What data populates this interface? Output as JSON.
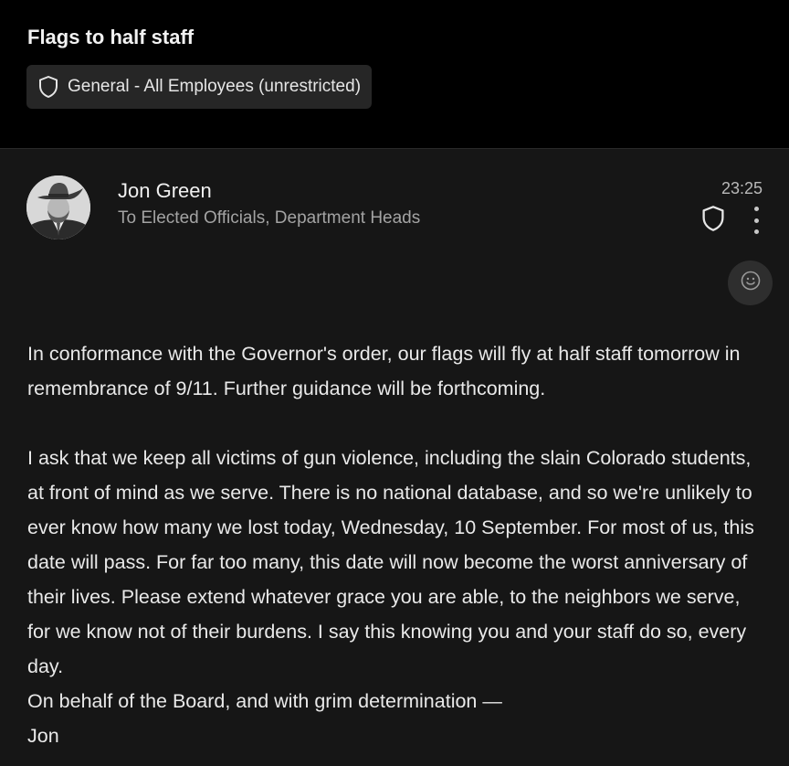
{
  "header": {
    "subject": "Flags to half staff",
    "sensitivity_label": "General - All Employees (unrestricted)",
    "sensitivity_icon": "shield-icon"
  },
  "message": {
    "sender_name": "Jon Green",
    "recipients": "To Elected Officials, Department Heads",
    "time": "23:25",
    "icons": {
      "sensitivity": "shield-icon",
      "more": "more-vertical-icon",
      "react": "smiley-icon"
    },
    "body": {
      "p1": "In conformance with the Governor's order, our flags will fly at half staff tomorrow in remembrance of 9/11. Further guidance will be forthcoming.",
      "p2": "I ask that we keep all victims of gun violence, including the slain Colorado students, at front of mind as we serve. There is no national database, and so we're unlikely to ever know how many we lost today, Wednesday, 10 September. For most of us, this date will pass. For far too many, this date will now become the worst anniversary of their lives. Please extend whatever grace you are able, to the neighbors we serve, for we know not of their burdens. I say this knowing you and your staff do so, every day.",
      "p3": "On behalf of the Board, and with grim determination —",
      "signature": "Jon"
    }
  },
  "colors": {
    "header_bg": "#000000",
    "page_bg": "#161616",
    "chip_bg": "#262626",
    "text_primary": "#eaeaea",
    "text_secondary": "#a3a3a3"
  }
}
